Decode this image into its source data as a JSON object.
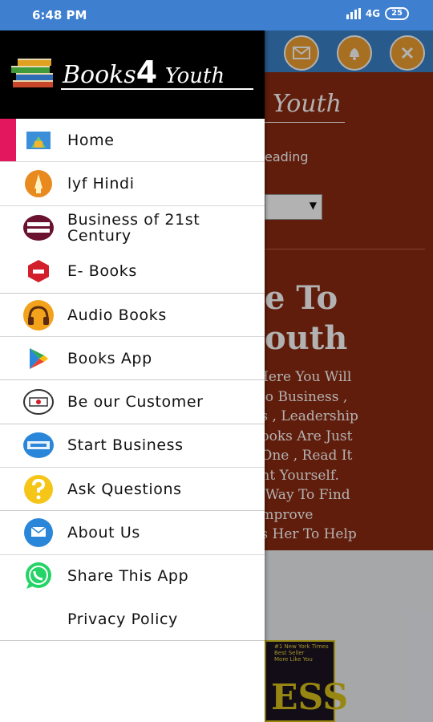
{
  "status": {
    "time": "6:48 PM",
    "network": "4G",
    "battery": "25"
  },
  "background": {
    "logo_text": "Youth",
    "reading_text": "eading",
    "heading_line1": "e To",
    "heading_line2": "outh",
    "paragraph": "Here You Will\n  o Business ,\n s , Leadership\n ooks Are Just\n One , Read It\n nt Yourself.\n  Way To Find\n mprove\n s Her To Help",
    "book_tag": "#1 New York Times\nBest Seller\nMore Like You",
    "book_title": "ESS"
  },
  "drawer": {
    "logo_part1": "Books",
    "logo_part2": "4",
    "logo_part3": "Youth",
    "menu": [
      {
        "label": "Home",
        "icon": "home-icon",
        "color": "#3b8fd8"
      },
      {
        "label": "lyf Hindi",
        "icon": "lyf-hindi-icon",
        "color": "#e88a1e"
      },
      {
        "label": "Business of 21st Century",
        "icon": "business-school-icon",
        "color": "#6a1230"
      },
      {
        "label": "E- Books",
        "icon": "ebooks-icon",
        "color": "#d21f2b"
      },
      {
        "label": "Audio Books",
        "icon": "headphones-icon",
        "color": "#f2a21b"
      },
      {
        "label": "Books App",
        "icon": "google-play-icon",
        "color": "#34a853"
      },
      {
        "label": "Be our Customer",
        "icon": "customer-icon",
        "color": "#333333"
      },
      {
        "label": "Start Business",
        "icon": "join-now-icon",
        "color": "#2a86d9"
      },
      {
        "label": "Ask Questions",
        "icon": "question-icon",
        "color": "#f5c518"
      },
      {
        "label": "About Us",
        "icon": "contact-icon",
        "color": "#2a86d9"
      },
      {
        "label": "Share This App",
        "icon": "whatsapp-icon",
        "color": "#25d366"
      },
      {
        "label": "Privacy Policy",
        "icon": "",
        "color": ""
      }
    ]
  }
}
